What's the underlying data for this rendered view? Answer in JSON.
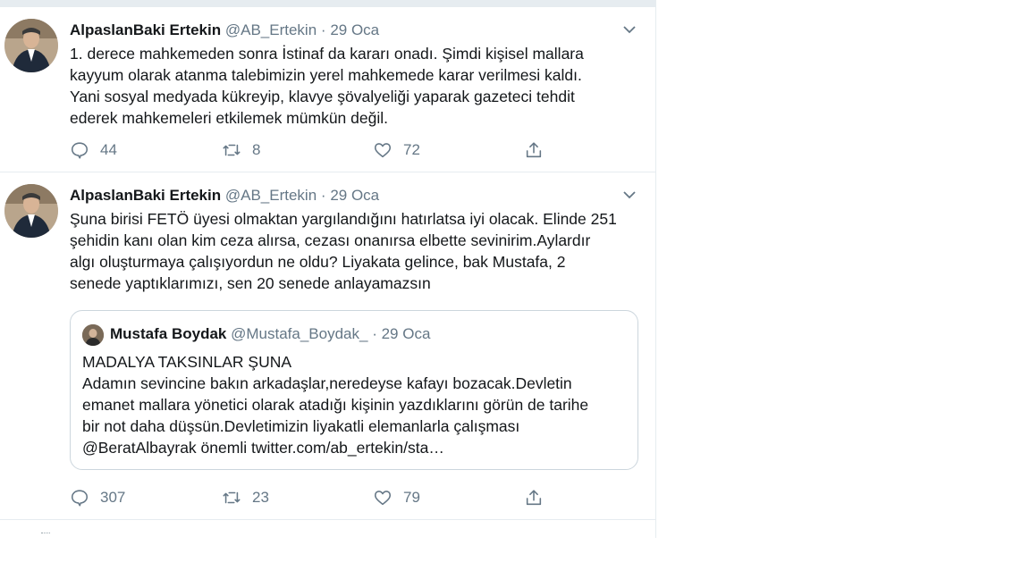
{
  "colors": {
    "text": "#14171a",
    "secondary": "#657786",
    "border": "#e6ecf0"
  },
  "tweets": [
    {
      "author": "AlpaslanBaki Ertekin",
      "handle": "@AB_Ertekin",
      "separator": "·",
      "date": "29 Oca",
      "text_lines": [
        "1. derece mahkemeden sonra İstinaf da kararı onadı. Şimdi kişisel mallara",
        "kayyum olarak atanma talebimizin yerel mahkemede karar verilmesi kaldı.",
        "Yani sosyal medyada kükreyip, klavye şövalyeliği yaparak gazeteci tehdit",
        "ederek mahkemeleri etkilemek mümkün değil."
      ],
      "replies": "44",
      "retweets": "8",
      "likes": "72"
    },
    {
      "author": "AlpaslanBaki Ertekin",
      "handle": "@AB_Ertekin",
      "separator": "·",
      "date": "29 Oca",
      "text_lines": [
        "Şuna birisi FETÖ üyesi olmaktan yargılandığını hatırlatsa iyi olacak. Elinde 251",
        "şehidin kanı olan kim ceza alırsa, cezası onanırsa elbette sevinirim.Aylardır",
        "algı oluşturmaya çalışıyordun ne oldu? Liyakata gelince, bak Mustafa, 2",
        "senede yaptıklarımızı, sen 20 senede anlayamazsın"
      ],
      "quote": {
        "author": "Mustafa Boydak",
        "handle": "@Mustafa_Boydak_",
        "separator": "·",
        "date": "29 Oca",
        "text_lines": [
          "MADALYA TAKSINLAR ŞUNA",
          "Adamın sevincine bakın arkadaşlar,neredeyse kafayı bozacak.Devletin",
          "emanet mallara yönetici olarak atadığı kişinin yazdıklarını görün de tarihe",
          "bir not daha düşsün.Devletimizin liyakatli elemanlarla çalışması",
          "@BeratAlbayrak önemli twitter.com/ab_ertekin/sta…"
        ]
      },
      "replies": "307",
      "retweets": "23",
      "likes": "79"
    }
  ],
  "icons": {
    "reply": "reply-icon",
    "retweet": "retweet-icon",
    "like": "heart-icon",
    "share": "share-icon",
    "more": "chevron-down-icon"
  }
}
